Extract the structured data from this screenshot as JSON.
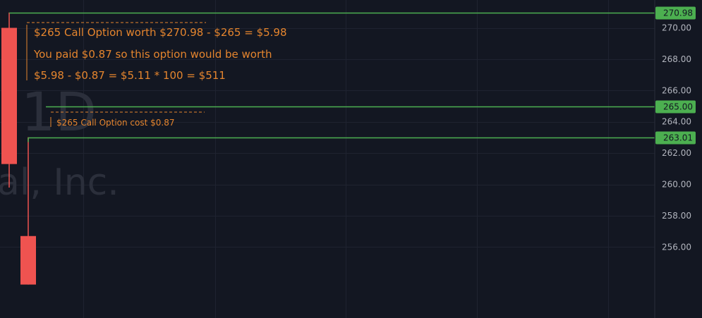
{
  "watermark": {
    "symbol": "1D",
    "company": "al, Inc."
  },
  "chart_data": {
    "type": "candlestick",
    "y_axis_ticks": [
      "270.00",
      "268.00",
      "266.00",
      "264.00",
      "262.00",
      "260.00",
      "258.00",
      "256.00"
    ],
    "ylim": [
      253.5,
      271.7
    ],
    "grid": true,
    "candles": [
      {
        "open": 270.0,
        "high": 270.98,
        "low": 259.8,
        "close": 261.3,
        "color": "#ef5350"
      },
      {
        "open": 256.7,
        "high": 263.01,
        "low": 253.6,
        "close": 253.6,
        "color": "#ef5350"
      }
    ],
    "price_lines": [
      {
        "label": "270.98",
        "value": 270.98,
        "color": "#4caf50"
      },
      {
        "label": "265.00",
        "value": 265.0,
        "color": "#4caf50"
      },
      {
        "label": "263.01",
        "value": 263.01,
        "color": "#4caf50"
      }
    ],
    "annotations": [
      {
        "lines": [
          "$265 Call Option worth $270.98 - $265 = $5.98",
          "You paid $0.87 so this option would be worth",
          "$5.98 - $0.87 = $5.11 * 100 = $511"
        ]
      },
      {
        "lines": [
          "$265 Call Option cost $0.87"
        ]
      }
    ]
  },
  "colors": {
    "background": "#131722",
    "grid": "#1f2330",
    "axis_text": "#b2b5be",
    "price_line": "#4caf50",
    "annotation": "#e5852e",
    "bear_candle": "#ef5350"
  }
}
